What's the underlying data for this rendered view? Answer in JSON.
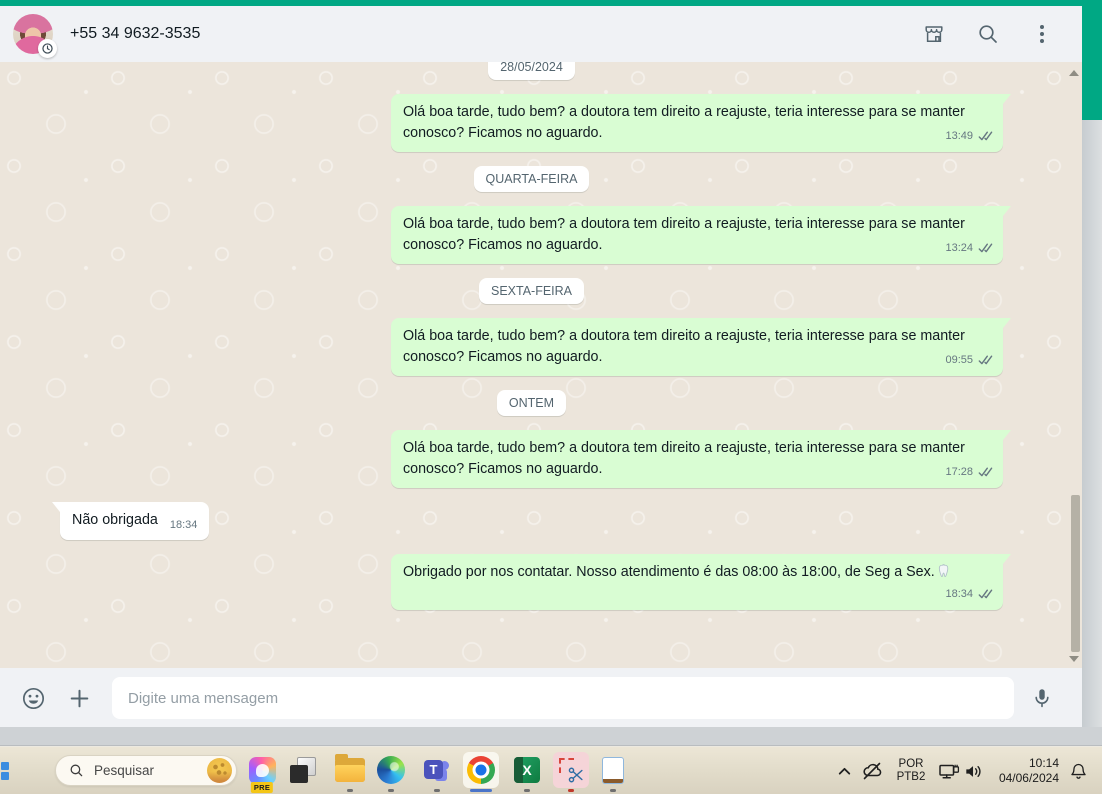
{
  "window": {
    "accent_teal": "#00a884",
    "colors": {
      "outgoing_bubble": "#d9fdd3",
      "incoming_bubble": "#ffffff",
      "chat_background": "#ece5db",
      "header_background": "#f0f2f5",
      "meta_text": "#667781"
    }
  },
  "header": {
    "contact_phone": "+55 34 9632-3535",
    "icons": [
      "storefront-icon",
      "search-icon",
      "kebab-menu-icon"
    ],
    "avatar_badge_icon": "clock-icon"
  },
  "chat": {
    "items": [
      {
        "type": "date_divider",
        "label": "28/05/2024"
      },
      {
        "type": "outgoing",
        "text": "Olá boa tarde, tudo bem? a doutora tem direito a reajuste, teria interesse para se manter conosco? Ficamos no aguardo.",
        "time": "13:49",
        "status": "delivered"
      },
      {
        "type": "date_divider",
        "label": "QUARTA-FEIRA"
      },
      {
        "type": "outgoing",
        "text": "Olá boa tarde, tudo bem? a doutora tem direito a reajuste, teria interesse para se manter conosco? Ficamos no aguardo.",
        "time": "13:24",
        "status": "delivered"
      },
      {
        "type": "date_divider",
        "label": "SEXTA-FEIRA"
      },
      {
        "type": "outgoing",
        "text": "Olá boa tarde, tudo bem? a doutora tem direito a reajuste, teria interesse para se manter conosco? Ficamos no aguardo.",
        "time": "09:55",
        "status": "delivered"
      },
      {
        "type": "date_divider",
        "label": "ONTEM"
      },
      {
        "type": "outgoing",
        "text": "Olá boa tarde, tudo bem? a doutora tem direito a reajuste, teria interesse para se manter conosco? Ficamos no aguardo.",
        "time": "17:28",
        "status": "delivered"
      },
      {
        "type": "incoming",
        "text": "Não obrigada",
        "time": "18:34"
      },
      {
        "type": "outgoing",
        "text": "Obrigado por nos contatar. Nosso atendimento é das 08:00 às 18:00, de Seg a Sex.",
        "emoji": "tooth",
        "time": "18:34",
        "status": "delivered"
      }
    ]
  },
  "composer": {
    "placeholder": "Digite uma mensagem",
    "icons": [
      "emoji-icon",
      "attach-plus-icon",
      "mic-icon"
    ]
  },
  "taskbar": {
    "search_placeholder": "Pesquisar",
    "search_highlight_icon": "cheese-icon",
    "copilot_badge": "PRE",
    "pinned_apps": [
      "copilot",
      "task-view",
      "file-explorer",
      "edge",
      "teams",
      "chrome",
      "excel",
      "snipping-tool",
      "notepad"
    ],
    "active_app": "chrome",
    "language_line1": "POR",
    "language_line2": "PTB2",
    "time": "10:14",
    "date": "04/06/2024",
    "tray_icons": [
      "chevron-up-icon",
      "onedrive-off-icon",
      "network-icon",
      "volume-icon",
      "bell-icon"
    ]
  }
}
